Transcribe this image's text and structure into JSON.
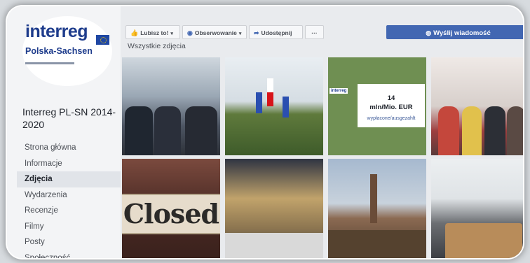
{
  "sidebar": {
    "logo": {
      "brand": "interreg",
      "program": "Polska-Sachsen"
    },
    "page_name": "Interreg PL-SN 2014-2020",
    "nav": [
      {
        "label": "Strona główna",
        "active": false
      },
      {
        "label": "Informacje",
        "active": false
      },
      {
        "label": "Zdjęcia",
        "active": true
      },
      {
        "label": "Wydarzenia",
        "active": false
      },
      {
        "label": "Recenzje",
        "active": false
      },
      {
        "label": "Filmy",
        "active": false
      },
      {
        "label": "Posty",
        "active": false
      },
      {
        "label": "Społeczność",
        "active": false
      }
    ]
  },
  "toolbar": {
    "like_label": "Lubisz to!",
    "follow_label": "Obserwowanie",
    "share_label": "Udostępnij",
    "more_label": "···",
    "message_label": "Wyślij wiadomość"
  },
  "section_title": "Wszystkie zdjęcia",
  "photos": {
    "funds_card": {
      "brand": "interreg",
      "amount": "14",
      "unit": "mln/Mio. EUR",
      "caption": "wypłacone/ausgezahlt"
    },
    "closed_sign": "Closed"
  },
  "colors": {
    "accent": "#4267b2",
    "brand": "#1e3c8c",
    "eu_blue": "#1f47a3"
  }
}
